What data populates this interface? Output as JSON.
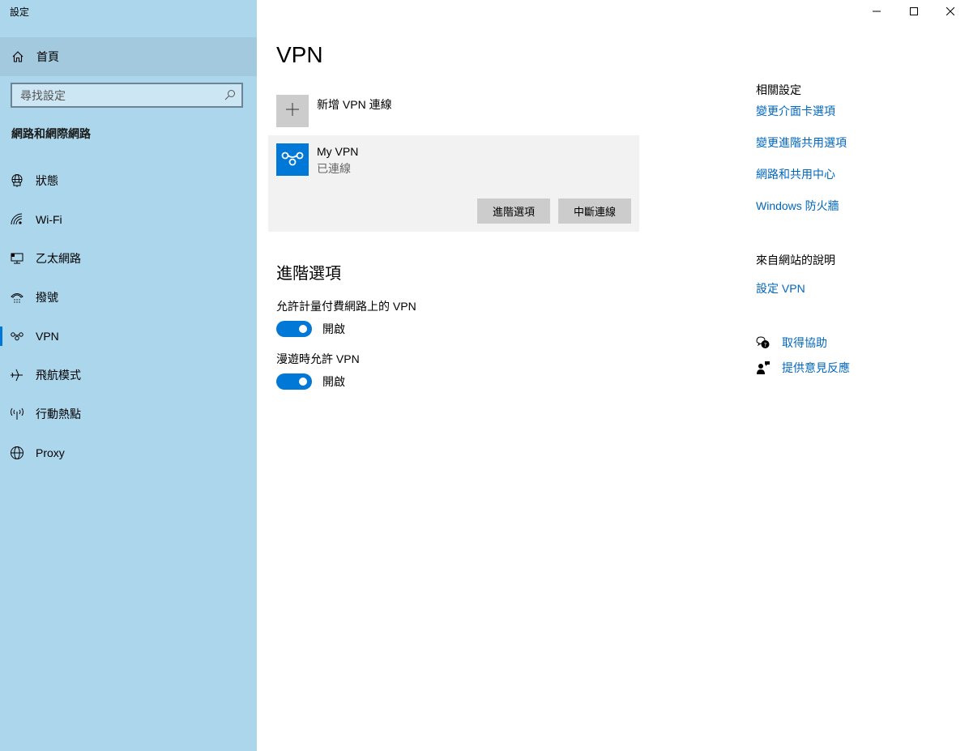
{
  "window": {
    "title": "設定",
    "controls": {
      "minimize": "minimize-icon",
      "maximize": "maximize-icon",
      "close": "close-icon"
    }
  },
  "sidebar": {
    "home": {
      "label": "首頁",
      "icon": "home-icon"
    },
    "search": {
      "placeholder": "尋找設定",
      "value": "",
      "icon": "search-icon"
    },
    "section_title": "網路和網際網路",
    "items": [
      {
        "label": "狀態",
        "icon": "status-globe-icon",
        "active": false
      },
      {
        "label": "Wi-Fi",
        "icon": "wifi-icon",
        "active": false
      },
      {
        "label": "乙太網路",
        "icon": "ethernet-icon",
        "active": false
      },
      {
        "label": "撥號",
        "icon": "dialup-icon",
        "active": false
      },
      {
        "label": "VPN",
        "icon": "vpn-icon",
        "active": true
      },
      {
        "label": "飛航模式",
        "icon": "airplane-icon",
        "active": false
      },
      {
        "label": "行動熱點",
        "icon": "hotspot-icon",
        "active": false
      },
      {
        "label": "Proxy",
        "icon": "globe-icon",
        "active": false
      }
    ]
  },
  "main": {
    "title": "VPN",
    "add_vpn_label": "新增 VPN 連線",
    "connection": {
      "name": "My VPN",
      "status": "已連線",
      "advanced_button": "進階選項",
      "disconnect_button": "中斷連線"
    },
    "advanced": {
      "title": "進階選項",
      "options": [
        {
          "label": "允許計量付費網路上的 VPN",
          "state": "開啟",
          "on": true
        },
        {
          "label": "漫遊時允許 VPN",
          "state": "開啟",
          "on": true
        }
      ]
    }
  },
  "right": {
    "related_heading": "相關設定",
    "related_links": [
      "變更介面卡選項",
      "變更進階共用選項",
      "網路和共用中心",
      "Windows 防火牆"
    ],
    "web_help_heading": "來自網站的說明",
    "web_help_links": [
      "設定 VPN"
    ],
    "help_items": [
      {
        "label": "取得協助",
        "icon": "get-help-icon"
      },
      {
        "label": "提供意見反應",
        "icon": "feedback-icon"
      }
    ]
  },
  "colors": {
    "accent": "#0078d7",
    "link": "#0067c0",
    "sidebar_bg": "#acd6ec"
  }
}
